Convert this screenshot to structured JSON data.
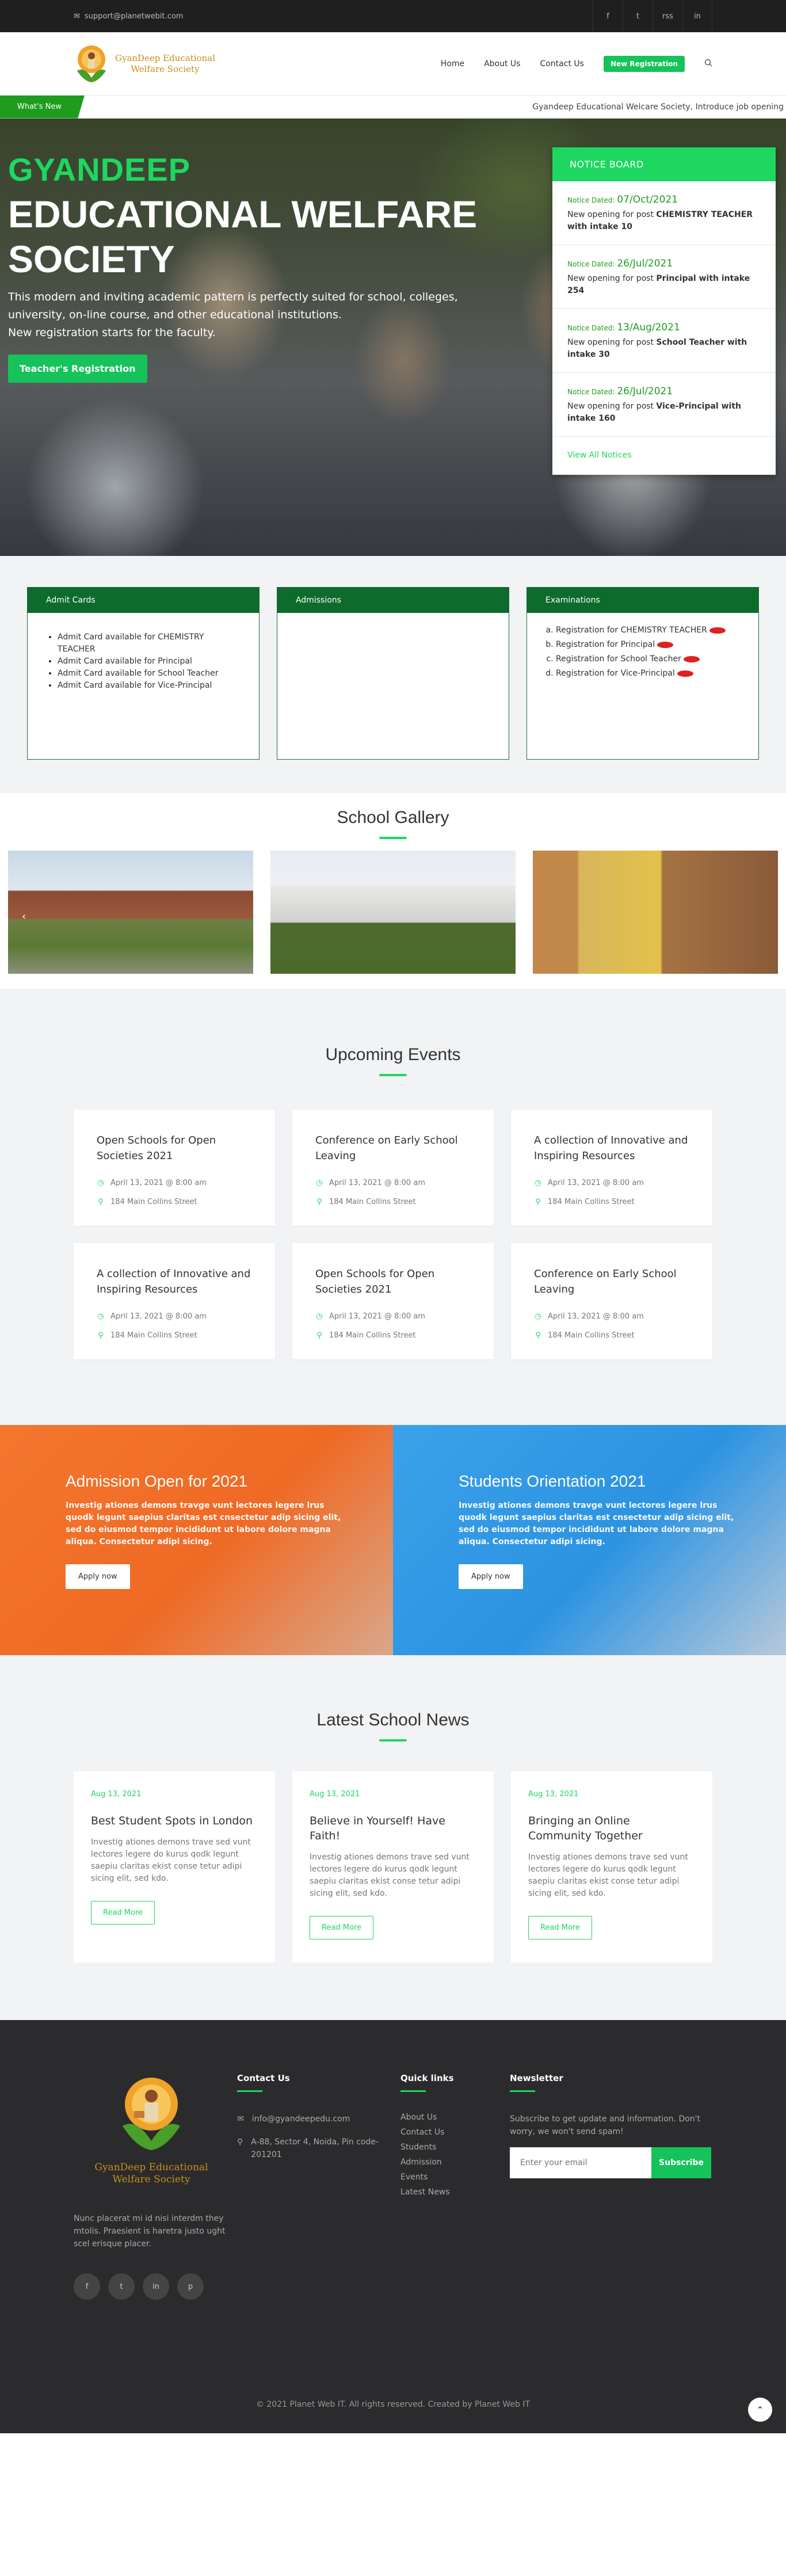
{
  "topbar": {
    "email": "support@planetwebit.com",
    "socials": [
      "f",
      "t",
      "rss",
      "in"
    ]
  },
  "header": {
    "logo_line1": "GyanDeep Educational",
    "logo_line2": "Welfare Society",
    "nav": [
      "Home",
      "About Us",
      "Contact Us"
    ],
    "register": "New Registration"
  },
  "ticker": {
    "tag": "What's New",
    "message": "Gyandeep Educational Welcare Society, Introduce job opening"
  },
  "hero": {
    "brand": "GYANDEEP",
    "title_line1": "EDUCATIONAL WELFARE",
    "title_line2": "SOCIETY",
    "desc_line1": "This modern and inviting academic pattern is perfectly suited for school, colleges,",
    "desc_line2": "university, on-line course, and other educational institutions.",
    "desc_line3": "New registration starts for the faculty.",
    "button": "Teacher's Registration"
  },
  "notice": {
    "title": "NOTICE BOARD",
    "date_label": "Notice Dated:",
    "items": [
      {
        "date": "07/Oct/2021",
        "pre": "New opening for post ",
        "bold": "CHEMISTRY TEACHER with intake 10"
      },
      {
        "date": "26/Jul/2021",
        "pre": "New opening for post ",
        "bold": "Principal with intake 254"
      },
      {
        "date": "13/Aug/2021",
        "pre": "New opening for post ",
        "bold": "School Teacher with intake 30"
      },
      {
        "date": "26/Jul/2021",
        "pre": "New opening for post ",
        "bold": "Vice-Principal with intake 160"
      }
    ],
    "view_all": "View All Notices"
  },
  "boxes": {
    "admit": {
      "title": "Admit Cards",
      "items": [
        "Admit Card available for CHEMISTRY TEACHER",
        "Admit Card available for Principal",
        "Admit Card available for School Teacher",
        "Admit Card available for Vice-Principal"
      ]
    },
    "admissions": {
      "title": "Admissions"
    },
    "exams": {
      "title": "Examinations",
      "items": [
        "Registration for CHEMISTRY TEACHER",
        "Registration for Principal",
        "Registration for School Teacher",
        "Registration for Vice-Principal"
      ]
    }
  },
  "gallery": {
    "title": "School Gallery"
  },
  "events": {
    "title": "Upcoming Events",
    "items": [
      {
        "title": "Open Schools for Open Societies 2021",
        "date": "April 13, 2021 @ 8:00 am",
        "place": "184 Main Collins Street"
      },
      {
        "title": "Conference on Early School Leaving",
        "date": "April 13, 2021 @ 8:00 am",
        "place": "184 Main Collins Street"
      },
      {
        "title": "A collection of Innovative and Inspiring Resources",
        "date": "April 13, 2021 @ 8:00 am",
        "place": "184 Main Collins Street"
      },
      {
        "title": "A collection of Innovative and Inspiring Resources",
        "date": "April 13, 2021 @ 8:00 am",
        "place": "184 Main Collins Street"
      },
      {
        "title": "Open Schools for Open Societies 2021",
        "date": "April 13, 2021 @ 8:00 am",
        "place": "184 Main Collins Street"
      },
      {
        "title": "Conference on Early School Leaving",
        "date": "April 13, 2021 @ 8:00 am",
        "place": "184 Main Collins Street"
      }
    ]
  },
  "promo": {
    "left": {
      "title": "Admission Open for 2021",
      "text": "Investig ationes demons travge vunt lectores legere lrus quodk legunt saepius claritas est cnsectetur adip sicing elit, sed do eiusmod tempor incididunt ut labore dolore magna aliqua. Consectetur adipi sicing.",
      "button": "Apply now"
    },
    "right": {
      "title": "Students Orientation 2021",
      "text": "Investig ationes demons travge vunt lectores legere lrus quodk legunt saepius claritas est cnsectetur adip sicing elit, sed do eiusmod tempor incididunt ut labore dolore magna aliqua. Consectetur adipi sicing.",
      "button": "Apply now"
    }
  },
  "news": {
    "title": "Latest School News",
    "items": [
      {
        "date": "Aug 13, 2021",
        "title": "Best Student Spots in London",
        "text": "Investig ationes demons trave sed vunt lectores legere do kurus qodk legunt saepiu claritas ekist conse tetur adipi sicing elit, sed kdo.",
        "button": "Read More"
      },
      {
        "date": "Aug 13, 2021",
        "title": "Believe in Yourself! Have Faith!",
        "text": "Investig ationes demons trave sed vunt lectores legere do kurus qodk legunt saepiu claritas ekist conse tetur adipi sicing elit, sed kdo.",
        "button": "Read More"
      },
      {
        "date": "Aug 13, 2021",
        "title": "Bringing an Online Community Together",
        "text": "Investig ationes demons trave sed vunt lectores legere do kurus qodk legunt saepiu claritas ekist conse tetur adipi sicing elit, sed kdo.",
        "button": "Read More"
      }
    ]
  },
  "footer": {
    "logo_line1": "GyanDeep Educational",
    "logo_line2": "Welfare Society",
    "about": "Nunc placerat mi id nisi interdm they mtolis. Praesient is haretra justo ught scel erisque placer.",
    "socials": [
      "f",
      "t",
      "in",
      "p"
    ],
    "contact_title": "Contact Us",
    "contact_email": "info@gyandeepedu.com",
    "contact_address": "A-88, Sector 4, Noida, Pin code-201201",
    "links_title": "Quick links",
    "links": [
      "About Us",
      "Contact Us",
      "Students",
      "Admission",
      "Events",
      "Latest News"
    ],
    "newsletter_title": "Newsletter",
    "newsletter_text": "Subscribe to get update and information. Don't worry, we won't send spam!",
    "email_placeholder": "Enter your email",
    "subscribe": "Subscribe",
    "copyright": "© 2021 Planet Web IT. All rights reserved. Created by Planet Web IT"
  },
  "colors": {
    "accent": "#1ed760",
    "brand_dark_green": "#0d6b2c",
    "orange": "#f4762f",
    "blue": "#2c93e2",
    "footer": "#2b2b2d"
  }
}
